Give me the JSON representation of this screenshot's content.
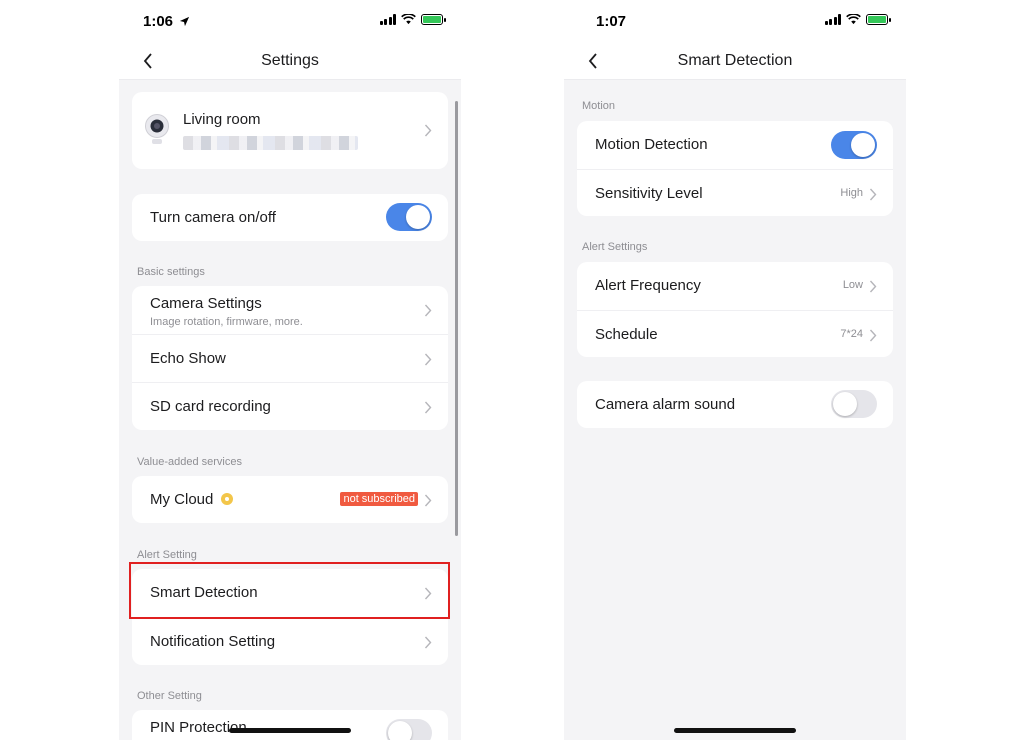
{
  "left_screen": {
    "time": "1:06",
    "title": "Settings",
    "device": {
      "name": "Living room"
    },
    "camera_power": {
      "label": "Turn camera on/off",
      "enabled": true
    },
    "basic_settings": {
      "heading": "Basic settings",
      "items": [
        {
          "label": "Camera Settings",
          "subtitle": "Image rotation, firmware, more."
        },
        {
          "label": "Echo Show"
        },
        {
          "label": "SD card recording"
        }
      ]
    },
    "value_added": {
      "heading": "Value-added services",
      "my_cloud": {
        "label": "My Cloud",
        "badge": "not subscribed"
      }
    },
    "alert_setting": {
      "heading": "Alert Setting",
      "items": [
        {
          "label": "Smart Detection"
        },
        {
          "label": "Notification Setting"
        }
      ]
    },
    "other_setting": {
      "heading": "Other Setting",
      "pin_protection": {
        "label": "PIN Protection",
        "enabled": false
      }
    }
  },
  "right_screen": {
    "time": "1:07",
    "title": "Smart Detection",
    "motion": {
      "heading": "Motion",
      "motion_detection": {
        "label": "Motion Detection",
        "enabled": true
      },
      "sensitivity": {
        "label": "Sensitivity Level",
        "value": "High"
      }
    },
    "alert_settings": {
      "heading": "Alert Settings",
      "frequency": {
        "label": "Alert Frequency",
        "value": "Low"
      },
      "schedule": {
        "label": "Schedule",
        "value": "7*24"
      }
    },
    "alarm_sound": {
      "label": "Camera alarm sound",
      "enabled": false
    }
  },
  "colors": {
    "toggle_on": "#4a86e8",
    "badge": "#f05a40",
    "highlight_box": "#e02020",
    "background": "#f4f4f6",
    "battery": "#34c759"
  },
  "icons": [
    "back-chevron-icon",
    "chevron-right-icon",
    "camera-device-icon",
    "cloud-coin-icon",
    "signal-icon",
    "wifi-icon",
    "battery-icon",
    "location-arrow-icon"
  ]
}
